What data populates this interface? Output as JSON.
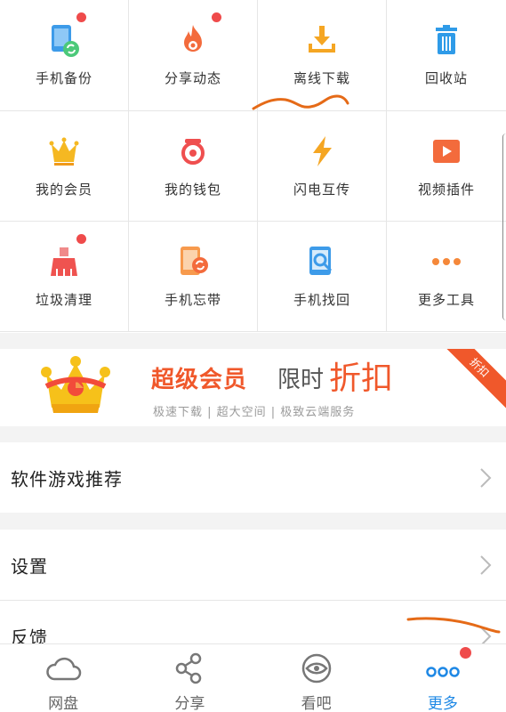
{
  "tools": [
    {
      "label": "手机备份",
      "icon": "phone-backup-icon",
      "badge": true
    },
    {
      "label": "分享动态",
      "icon": "flame-icon",
      "badge": true
    },
    {
      "label": "离线下载",
      "icon": "download-tray-icon",
      "badge": false
    },
    {
      "label": "回收站",
      "icon": "trash-icon",
      "badge": false
    },
    {
      "label": "我的会员",
      "icon": "crown-icon",
      "badge": false
    },
    {
      "label": "我的钱包",
      "icon": "wallet-icon",
      "badge": false
    },
    {
      "label": "闪电互传",
      "icon": "lightning-icon",
      "badge": false
    },
    {
      "label": "视频插件",
      "icon": "video-play-icon",
      "badge": false
    },
    {
      "label": "垃圾清理",
      "icon": "broom-icon",
      "badge": true
    },
    {
      "label": "手机忘带",
      "icon": "phone-sync-icon",
      "badge": false
    },
    {
      "label": "手机找回",
      "icon": "phone-search-icon",
      "badge": false
    },
    {
      "label": "更多工具",
      "icon": "more-dots-icon",
      "badge": false
    }
  ],
  "banner": {
    "title": "超级会员",
    "promo_prefix": "限时",
    "promo_emphasis": "折扣",
    "subtitle": "极速下载 | 超大空间 | 极致云端服务",
    "ribbon": "折扣"
  },
  "menu": {
    "recommend": "软件游戏推荐",
    "settings": "设置",
    "feedback": "反馈"
  },
  "tabs": [
    {
      "label": "网盘",
      "icon": "cloud-icon"
    },
    {
      "label": "分享",
      "icon": "share-icon"
    },
    {
      "label": "看吧",
      "icon": "eye-icon"
    },
    {
      "label": "更多",
      "icon": "more-dots-icon"
    }
  ],
  "colors": {
    "accent": "#1e88e5",
    "promo": "#f0582b",
    "badge": "#ef4b4b",
    "annotation": "#e56a17"
  }
}
